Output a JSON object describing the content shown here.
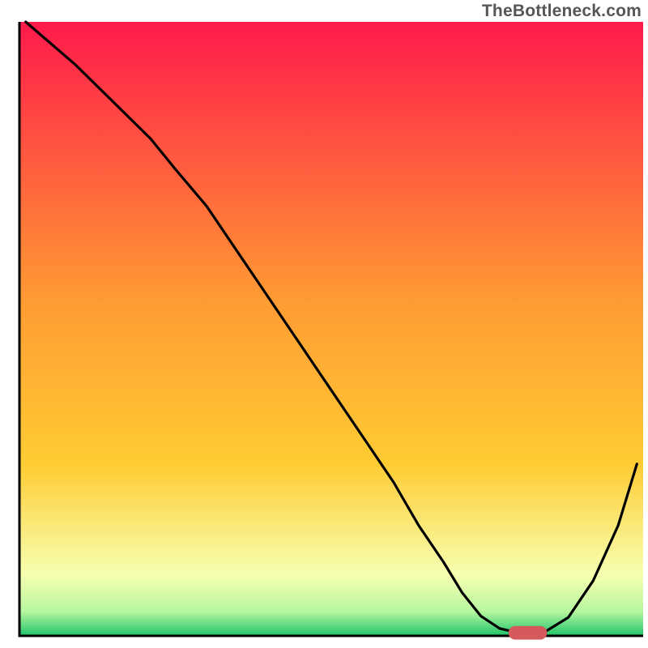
{
  "watermark": "TheBottleneck.com",
  "chart_data": {
    "type": "line",
    "title": "",
    "xlabel": "",
    "ylabel": "",
    "xlim": [
      0,
      100
    ],
    "ylim": [
      0,
      100
    ],
    "colors": {
      "gradient_top": "#ff1a4b",
      "gradient_mid": "#ffcc33",
      "gradient_low": "#f7ffb0",
      "gradient_bottom": "#1fc46a",
      "curve": "#000000",
      "marker": "#d45a5c"
    },
    "x": [
      1,
      9,
      21,
      25,
      30,
      35,
      40,
      45,
      50,
      55,
      60,
      64,
      68,
      71,
      74,
      77,
      80,
      84,
      88,
      92,
      96,
      99
    ],
    "values": [
      100,
      93,
      81,
      76,
      70,
      62.5,
      55,
      47.5,
      40,
      32.5,
      25,
      18,
      12,
      7,
      3.2,
      1.2,
      0.5,
      0.5,
      3,
      9,
      18,
      28
    ],
    "marker": {
      "x": 81.5,
      "y": 0.5,
      "rx": 3.1,
      "ry": 1.1
    }
  }
}
